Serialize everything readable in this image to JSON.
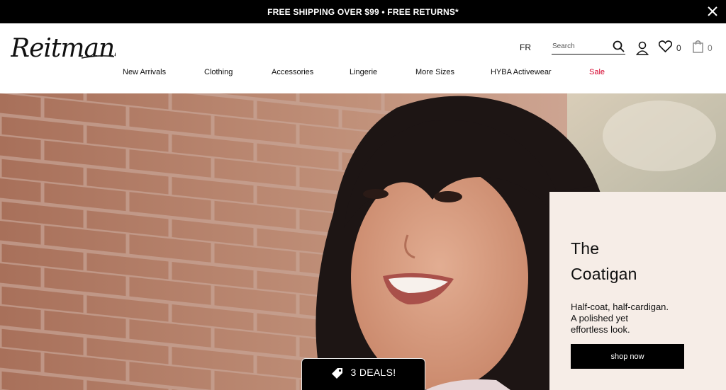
{
  "promo": {
    "text": "FREE SHIPPING OVER $99 • FREE RETURNS*",
    "close_icon": "close-icon"
  },
  "brand": {
    "logo_text": "Reitmans"
  },
  "header": {
    "language": "FR",
    "search": {
      "placeholder": "Search",
      "icon": "search-icon"
    },
    "account_icon": "user-icon",
    "wishlist": {
      "icon": "heart-icon",
      "count": "0"
    },
    "bag": {
      "icon": "shopping-bag-icon",
      "count": "0"
    }
  },
  "nav": {
    "items": [
      {
        "label": "New Arrivals"
      },
      {
        "label": "Clothing"
      },
      {
        "label": "Accessories"
      },
      {
        "label": "Lingerie"
      },
      {
        "label": "More Sizes"
      },
      {
        "label": "HYBA Activewear"
      },
      {
        "label": "Sale"
      }
    ]
  },
  "hero": {
    "title_line1": "The",
    "title_line2": "Coatigan",
    "desc_line1": "Half-coat, half-cardigan.",
    "desc_line2": "A polished yet",
    "desc_line3": "effortless look.",
    "cta": "shop now"
  },
  "deals": {
    "icon": "price-tag-icon",
    "label": "3 DEALS!"
  },
  "colors": {
    "promo_bg": "#000000",
    "sale_red": "#d4002a",
    "card_bg": "#f6ede7",
    "button_bg": "#000000"
  }
}
